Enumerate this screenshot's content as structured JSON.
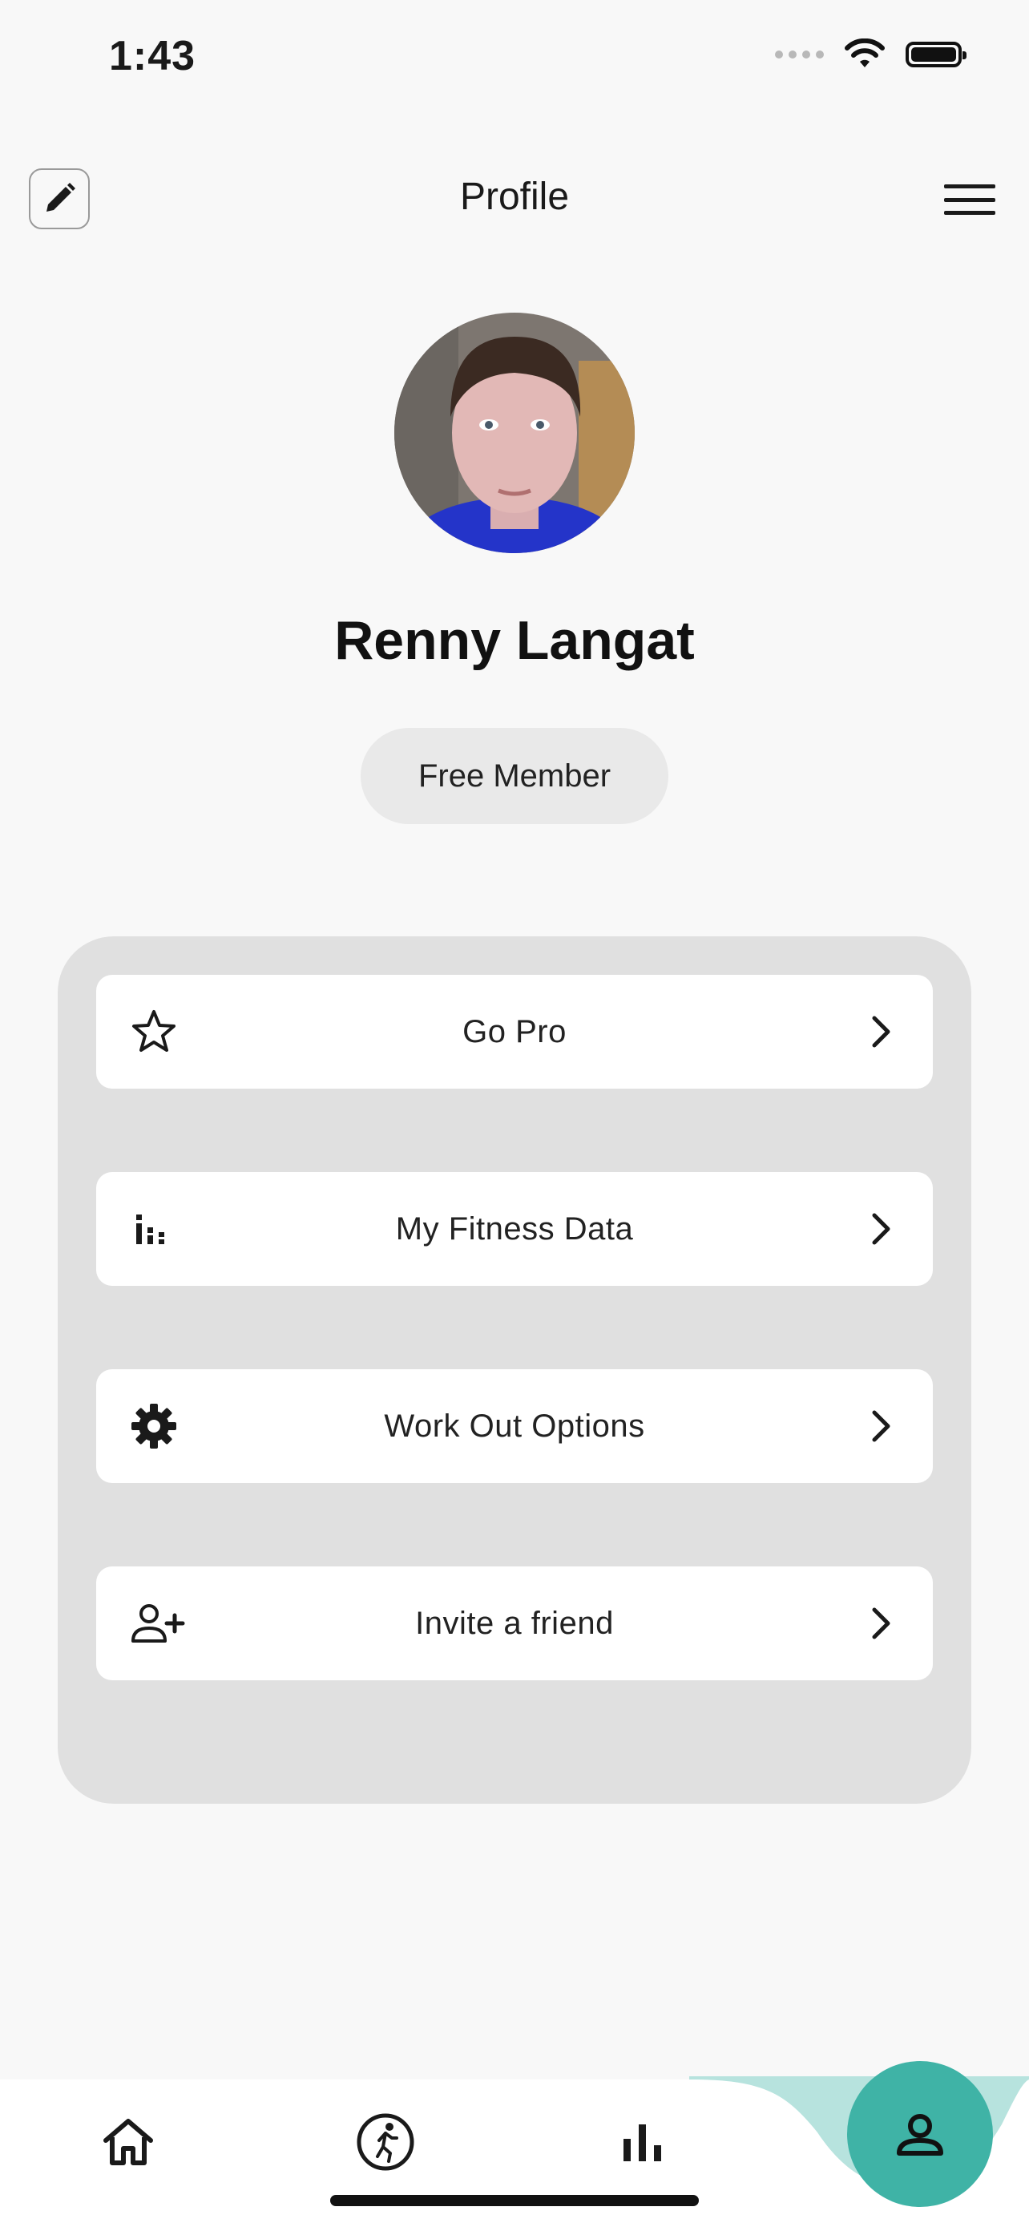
{
  "status_bar": {
    "time": "1:43"
  },
  "header": {
    "title": "Profile"
  },
  "profile": {
    "name": "Renny Langat",
    "membership": "Free Member"
  },
  "options": [
    {
      "label": "Go Pro",
      "icon": "star-icon"
    },
    {
      "label": "My Fitness Data",
      "icon": "chart-bars-icon"
    },
    {
      "label": "Work Out Options",
      "icon": "gear-icon"
    },
    {
      "label": "Invite a friend",
      "icon": "add-person-icon"
    }
  ],
  "bottom_nav": {
    "items": [
      "home-icon",
      "run-icon",
      "stats-icon",
      "profile-icon"
    ],
    "active": "profile"
  },
  "colors": {
    "accent": "#3fb3a6",
    "wave": "#b7e3de",
    "panel": "#e0e0e0"
  }
}
